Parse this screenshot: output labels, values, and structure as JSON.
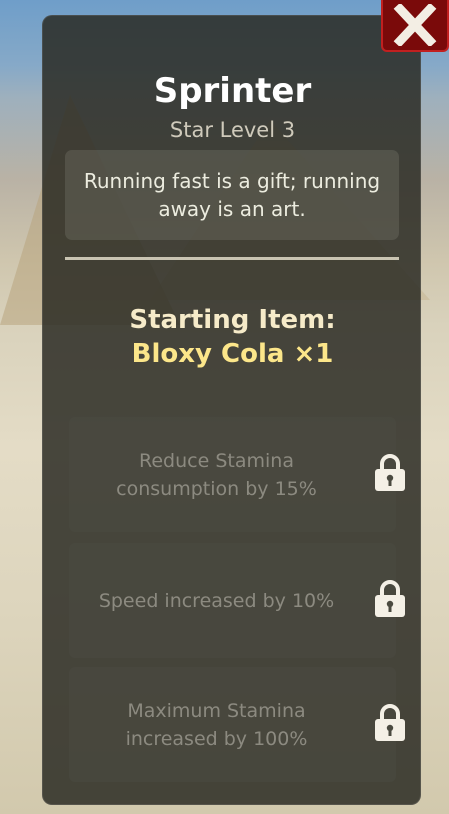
{
  "window": {
    "close_icon": "close-x-icon",
    "close_color": "#7a0a0a"
  },
  "header": {
    "title": "Sprinter",
    "subtitle": "Star Level 3"
  },
  "quote": "Running fast is a gift; running away is an art.",
  "starting_item": {
    "label": "Starting Item:",
    "value": "Bloxy Cola ×1"
  },
  "perks": [
    {
      "text": "Reduce Stamina consumption by 15%",
      "locked": true,
      "icon": "lock-icon"
    },
    {
      "text": "Speed increased by 10%",
      "locked": true,
      "icon": "lock-icon"
    },
    {
      "text": "Maximum Stamina increased by 100%",
      "locked": true,
      "icon": "lock-icon"
    }
  ],
  "colors": {
    "panel": "#28281f",
    "title": "#ffffff",
    "item_value": "#fce68a",
    "perk_text_locked": "#8c8a80"
  }
}
